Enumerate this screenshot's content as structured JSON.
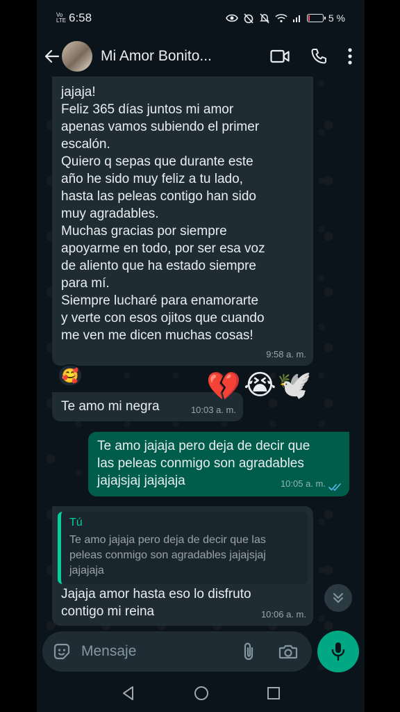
{
  "status_bar": {
    "network_label": "Vo LTE",
    "time": "6:58",
    "battery_text": "5 %",
    "battery_level_percent": 5
  },
  "header": {
    "contact_name": "Mi Amor Bonito...",
    "icons": [
      "back-arrow-icon",
      "video-call-icon",
      "phone-call-icon",
      "more-vert-icon"
    ]
  },
  "messages": [
    {
      "direction": "incoming",
      "lines": [
        "jajaja!",
        "Feliz 365 días juntos mi amor",
        "apenas vamos subiendo el primer",
        "escalón.",
        "Quiero q sepas que durante este",
        "año he sido muy feliz a tu lado,",
        "hasta las peleas contigo han sido",
        "muy agradables.",
        "Muchas gracias por siempre",
        "apoyarme en todo, por ser esa voz",
        "de aliento que ha estado siempre",
        "para mí.",
        "Siempre lucharé para enamorarte",
        "y verte con esos ojitos que cuando",
        "me ven me dicen muchas cosas!"
      ],
      "time": "9:58 a. m.",
      "reaction": "🥰"
    },
    {
      "direction": "incoming",
      "lines": [
        "Te amo mi negra"
      ],
      "time": "10:03 a. m.",
      "stickers": [
        "💔",
        "😭",
        "🕊️"
      ]
    },
    {
      "direction": "outgoing",
      "lines": [
        "Te amo jajaja pero deja de decir que",
        "las peleas conmigo son agradables",
        "jajajsjaj jajajaja"
      ],
      "time": "10:05 a. m.",
      "status": "read"
    },
    {
      "direction": "incoming",
      "quote": {
        "author": "Tú",
        "lines": [
          "Te amo jajaja pero deja de decir que las",
          "peleas conmigo son agradables  jajajsjaj",
          "jajajaja"
        ]
      },
      "lines": [
        "Jajaja amor hasta eso lo disfruto",
        "contigo mi reina"
      ],
      "time": "10:06 a. m."
    }
  ],
  "input": {
    "placeholder": "Mensaje"
  },
  "colors": {
    "background": "#0b141a",
    "incoming_bubble": "#1f2c34",
    "outgoing_bubble": "#005c4b",
    "accent": "#00a884",
    "quote_accent": "#06cf9c"
  }
}
